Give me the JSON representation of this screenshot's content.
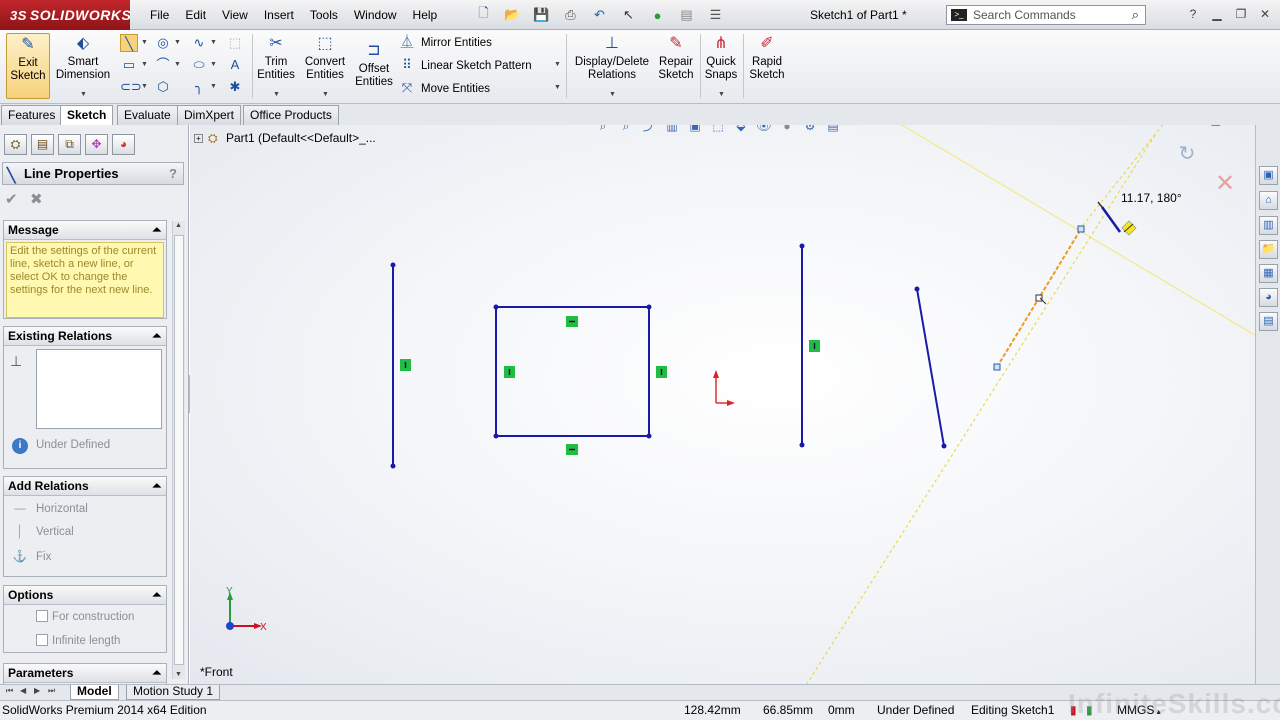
{
  "app": {
    "brand": "SOLIDWORKS",
    "brand_prefix": "3S",
    "document_title": "Sketch1 of Part1 *",
    "search_placeholder": "Search Commands"
  },
  "menus": [
    "File",
    "Edit",
    "View",
    "Insert",
    "Tools",
    "Window",
    "Help"
  ],
  "command_manager": {
    "exit_sketch": "Exit Sketch",
    "smart_dimension": "Smart Dimension",
    "trim_entities": "Trim Entities",
    "convert_entities": "Convert Entities",
    "offset_entities": "Offset Entities",
    "mirror_entities": "Mirror Entities",
    "linear_sketch_pattern": "Linear Sketch Pattern",
    "move_entities": "Move Entities",
    "display_delete_relations": "Display/Delete Relations",
    "repair_sketch": "Repair Sketch",
    "quick_snaps": "Quick Snaps",
    "rapid_sketch": "Rapid Sketch"
  },
  "tabs": [
    "Features",
    "Sketch",
    "Evaluate",
    "DimXpert",
    "Office Products"
  ],
  "active_tab": "Sketch",
  "property_manager": {
    "title": "Line Properties",
    "help": "?",
    "message_header": "Message",
    "message_text": "Edit the settings of the current line, sketch a new line, or select OK to change the settings for the next new line.",
    "existing_relations_header": "Existing Relations",
    "status": "Under Defined",
    "add_relations_header": "Add Relations",
    "add_relations": [
      "Horizontal",
      "Vertical",
      "Fix"
    ],
    "options_header": "Options",
    "options": [
      "For construction",
      "Infinite length"
    ],
    "parameters_header": "Parameters"
  },
  "graphics": {
    "tree_item": "Part1  (Default<<Default>_...",
    "view_name": "*Front",
    "cursor_label": "11.17, 180°",
    "accent_color": "#1a1aa8",
    "relation_color": "#22bb44",
    "axis_x_label": "X",
    "axis_y_label": "Y"
  },
  "bottom_tabs": [
    "Model",
    "Motion Study 1"
  ],
  "status_bar": {
    "edition": "SolidWorks Premium 2014 x64 Edition",
    "x": "128.42mm",
    "y": "66.85mm",
    "z": "0mm",
    "definition": "Under Defined",
    "editing": "Editing Sketch1",
    "units": "MMGS"
  },
  "watermark": "InfiniteSkills.com"
}
